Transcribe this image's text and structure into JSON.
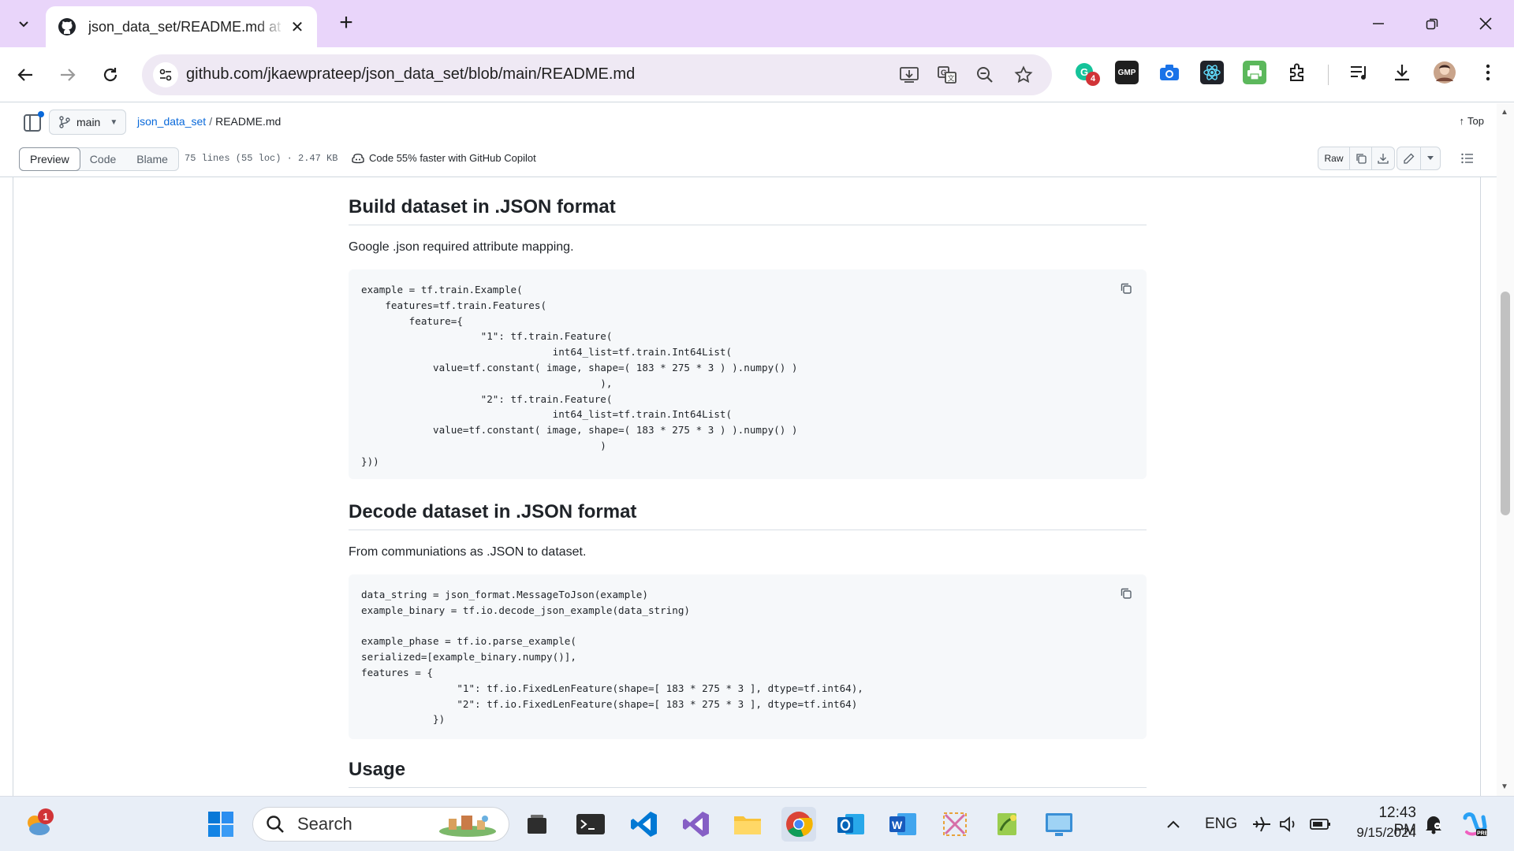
{
  "browser": {
    "tab_title": "json_data_set/README.md at main",
    "url_host": "github.com",
    "url_path": "/jkaewprateep/json_data_set/blob/main/README.md",
    "extension_badge": "4",
    "extension_gmp_label": "GMP"
  },
  "file_header": {
    "branch": "main",
    "repo": "json_data_set",
    "separator": "/",
    "filename": "README.md",
    "top_label": "Top",
    "tabs": [
      "Preview",
      "Code",
      "Blame"
    ],
    "file_info": "75 lines (55 loc) · 2.47 KB",
    "copilot_text": "Code 55% faster with GitHub Copilot",
    "raw_label": "Raw"
  },
  "readme": {
    "section1_title": "Build dataset in .JSON format",
    "section1_text": "Google .json required attribute mapping.",
    "code1": "example = tf.train.Example(\n    features=tf.train.Features(\n        feature={\n                    \"1\": tf.train.Feature(\n                                int64_list=tf.train.Int64List(\n            value=tf.constant( image, shape=( 183 * 275 * 3 ) ).numpy() )\n                                        ),\n                    \"2\": tf.train.Feature(\n                                int64_list=tf.train.Int64List(\n            value=tf.constant( image, shape=( 183 * 275 * 3 ) ).numpy() )\n                                        )\n}))",
    "section2_title": "Decode dataset in .JSON format",
    "section2_text": "From communiations as .JSON to dataset.",
    "code2": "data_string = json_format.MessageToJson(example)\nexample_binary = tf.io.decode_json_example(data_string)\n\nexample_phase = tf.io.parse_example(\nserialized=[example_binary.numpy()],\nfeatures = {\n                \"1\": tf.io.FixedLenFeature(shape=[ 183 * 275 * 3 ], dtype=tf.int64),\n                \"2\": tf.io.FixedLenFeature(shape=[ 183 * 275 * 3 ], dtype=tf.int64)\n            })",
    "section3_title": "Usage"
  },
  "taskbar": {
    "weather_badge": "1",
    "search_placeholder": "Search",
    "lang": "ENG",
    "time": "12:43 PM",
    "date": "9/15/2024"
  },
  "colors": {
    "tabstrip": "#e9d5fa",
    "link": "#0969da",
    "code_bg": "#f6f8fa",
    "taskbar": "#e8eef7"
  }
}
